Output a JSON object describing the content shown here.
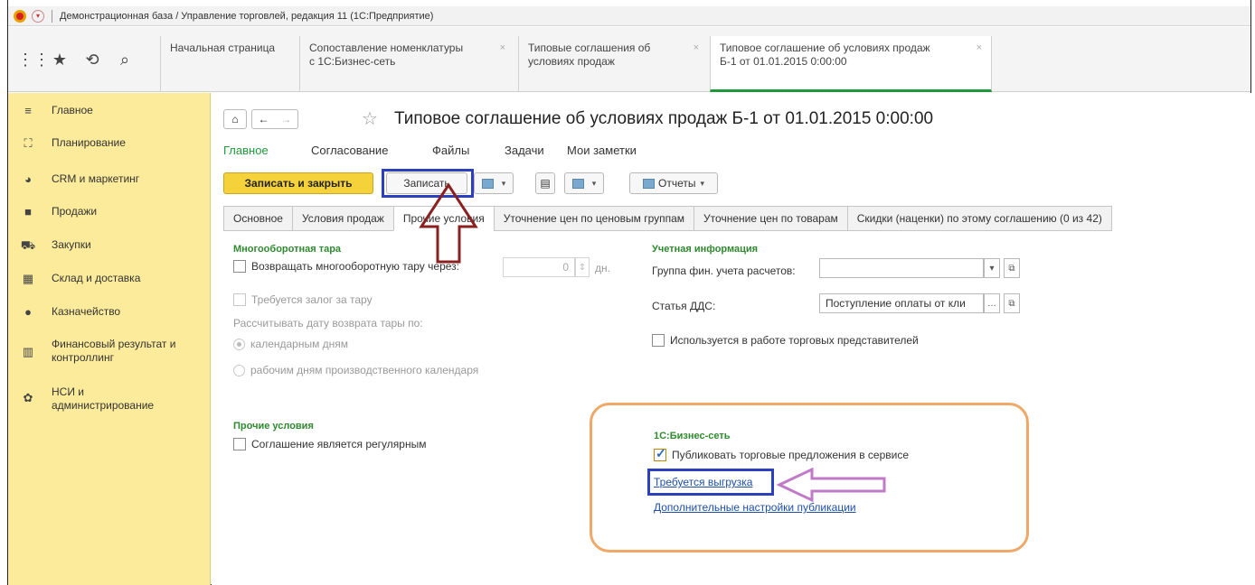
{
  "window": {
    "title": "Демонстрационная база / Управление торговлей, редакция 11  (1С:Предприятие)"
  },
  "top_icons": [
    "apps-grid-icon",
    "star-icon",
    "history-icon",
    "search-icon"
  ],
  "tabs": [
    {
      "label_line1": "Начальная страница",
      "label_line2": ""
    },
    {
      "label_line1": "Сопоставление номенклатуры",
      "label_line2": "с 1С:Бизнес-сеть"
    },
    {
      "label_line1": "Типовые соглашения об",
      "label_line2": "условиях продаж"
    },
    {
      "label_line1": "Типовое соглашение об условиях продаж",
      "label_line2": "Б-1 от 01.01.2015 0:00:00"
    }
  ],
  "sidebar": {
    "items": [
      {
        "label": "Главное",
        "label2": "",
        "icon": "menu-lines-icon"
      },
      {
        "label": "Планирование",
        "label2": "",
        "icon": "planning-icon"
      },
      {
        "label": "CRM и маркетинг",
        "label2": "",
        "icon": "pie-chart-icon"
      },
      {
        "label": "Продажи",
        "label2": "",
        "icon": "bag-icon"
      },
      {
        "label": "Закупки",
        "label2": "",
        "icon": "cart-icon"
      },
      {
        "label": "Склад и доставка",
        "label2": "",
        "icon": "warehouse-icon"
      },
      {
        "label": "Казначейство",
        "label2": "",
        "icon": "treasury-icon"
      },
      {
        "label": "Финансовый результат и",
        "label2": "контроллинг",
        "icon": "bar-chart-icon"
      },
      {
        "label": "НСИ и",
        "label2": "администрирование",
        "icon": "gear-icon"
      }
    ]
  },
  "document": {
    "title": "Типовое соглашение об условиях продаж Б-1 от 01.01.2015 0:00:00",
    "subnav": [
      "Главное",
      "Согласование",
      "Файлы",
      "Задачи",
      "Мои заметки"
    ],
    "toolbar": {
      "save_close": "Записать и закрыть",
      "save": "Записать",
      "reports": "Отчеты"
    },
    "tabs": [
      "Основное",
      "Условия продаж",
      "Прочие условия",
      "Уточнение цен по ценовым группам",
      "Уточнение цен по товарам",
      "Скидки (наценки) по этому соглашению (0 из 42)"
    ]
  },
  "form": {
    "tare": {
      "header": "Многооборотная тара",
      "return_label": "Возвращать многооборотную тару через:",
      "days_value": "0",
      "days_unit": "дн.",
      "deposit_label": "Требуется залог за тару",
      "calc_label": "Рассчитывать дату возврата тары по:",
      "option_calendar": "календарным дням",
      "option_work": "рабочим дням производственного календаря"
    },
    "accounting": {
      "header": "Учетная информация",
      "fin_group_label": "Группа фин. учета расчетов:",
      "fin_group_value": "",
      "dds_label": "Статья ДДС:",
      "dds_value": "Поступление оплаты от кли",
      "reps_label": "Используется в работе торговых представителей"
    },
    "other": {
      "header": "Прочие условия",
      "regular_label": "Соглашение является регулярным"
    },
    "business_net": {
      "header": "1С:Бизнес-сеть",
      "publish_label": "Публиковать торговые предложения в сервисе",
      "publish_checked": true,
      "upload_link": "Требуется выгрузка",
      "settings_link": "Дополнительные настройки публикации"
    }
  },
  "colors": {
    "sidebar_bg": "#fbeb9a",
    "accent_green": "#1d9a3a",
    "primary_button": "#f6d23a",
    "highlight_blue": "#2b3fbf",
    "highlight_orange": "#f0a868",
    "arrow_red": "#8a2020",
    "arrow_purple": "#c07ac8"
  }
}
